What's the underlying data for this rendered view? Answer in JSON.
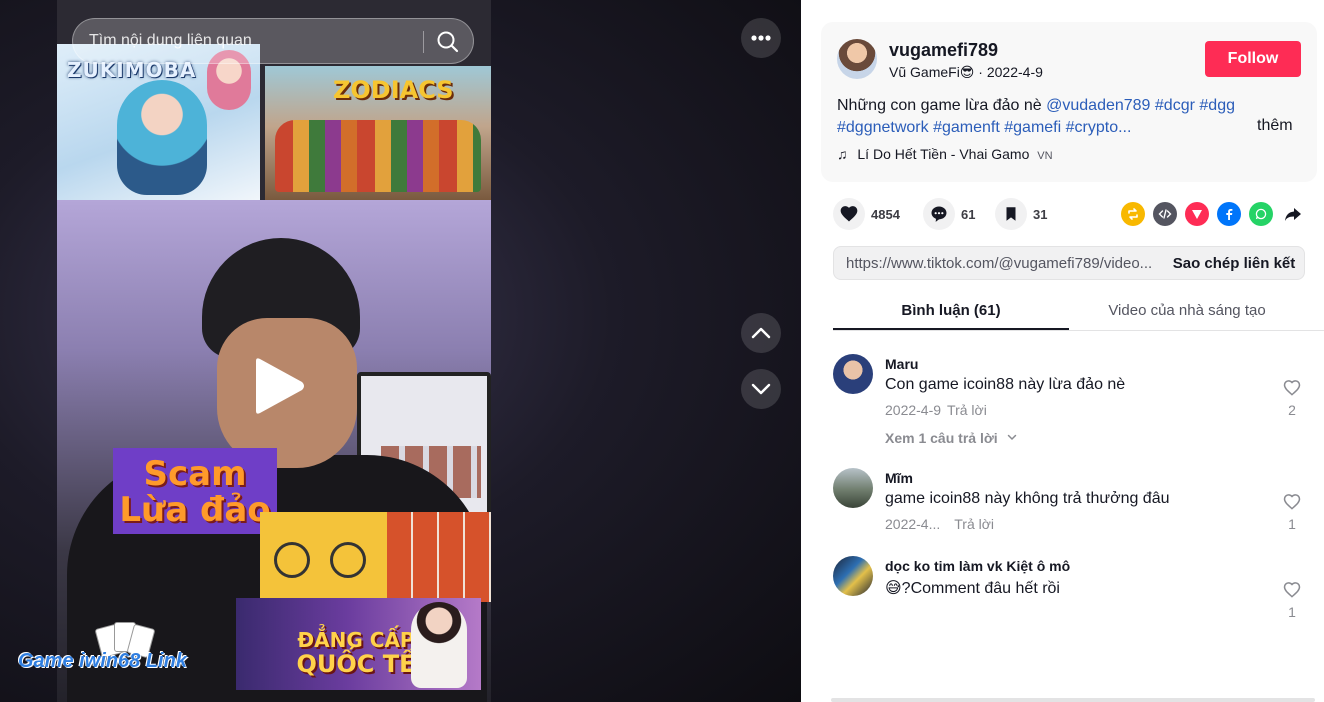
{
  "search": {
    "placeholder": "Tìm nội dung liên quan"
  },
  "video": {
    "overlay_texts": {
      "zuki_logo": "ZUKIMOBA",
      "zodiacs_logo": "ZODIACS",
      "scam_line1": "Scam",
      "scam_line2": "Lừa đảo",
      "promo_line1": "ĐẲNG CẤP",
      "promo_line2": "QUỐC TẾ",
      "watermark": "Game iwin68 Link"
    }
  },
  "author": {
    "username": "vugamefi789",
    "display_name": "Vũ GameFi😎",
    "separator": " · ",
    "date": "2022-4-9",
    "follow_label": "Follow"
  },
  "caption": {
    "text": "Những con game lừa đảo nè",
    "tags_line1": [
      "@vudaden789",
      "#dcgr",
      "#dgg"
    ],
    "tags_line2": [
      "#dggnetwork",
      "#gamenft",
      "#gamefi",
      "#crypto..."
    ],
    "more_label": "thêm"
  },
  "music": {
    "icon": "♫",
    "title": "Lí Do Hết Tiền - Vhai Gamo",
    "region": "VN"
  },
  "actions": {
    "likes": "4854",
    "comments": "61",
    "saves": "31"
  },
  "share_icons": [
    {
      "name": "repost-icon",
      "color": "#f8b800"
    },
    {
      "name": "embed-icon",
      "color": "#545560"
    },
    {
      "name": "send-icon",
      "color": "#fe2c55"
    },
    {
      "name": "facebook-icon",
      "color": "#0075fa"
    },
    {
      "name": "whatsapp-icon",
      "color": "#25d366"
    },
    {
      "name": "share-arrow-icon",
      "color": "#161823"
    }
  ],
  "link": {
    "url": "https://www.tiktok.com/@vugamefi789/video...",
    "copy_label": "Sao chép liên kết"
  },
  "tabs": {
    "comments": "Bình luận (61)",
    "creator_videos": "Video của nhà sáng tạo"
  },
  "comments": [
    {
      "name": "Maru",
      "text": "Con game icoin88 này lừa đảo nè",
      "date": "2022-4-9",
      "reply": "Trả lời",
      "likes": "2",
      "view_replies": "Xem 1 câu trả lời"
    },
    {
      "name": "Mĩm",
      "text": "game icoin88 này không trả thưởng đâu",
      "date": "2022-4...",
      "reply": "Trả lời",
      "likes": "1"
    },
    {
      "name": "dọc ko tim làm vk Kiệt ô mô",
      "text": "😅?Comment đâu hết rồi",
      "date": "",
      "reply": "",
      "likes": "1"
    }
  ],
  "colors": {
    "follow": "#fe2c55",
    "tag": "#2b5db9",
    "muted": "#8a8b91"
  }
}
